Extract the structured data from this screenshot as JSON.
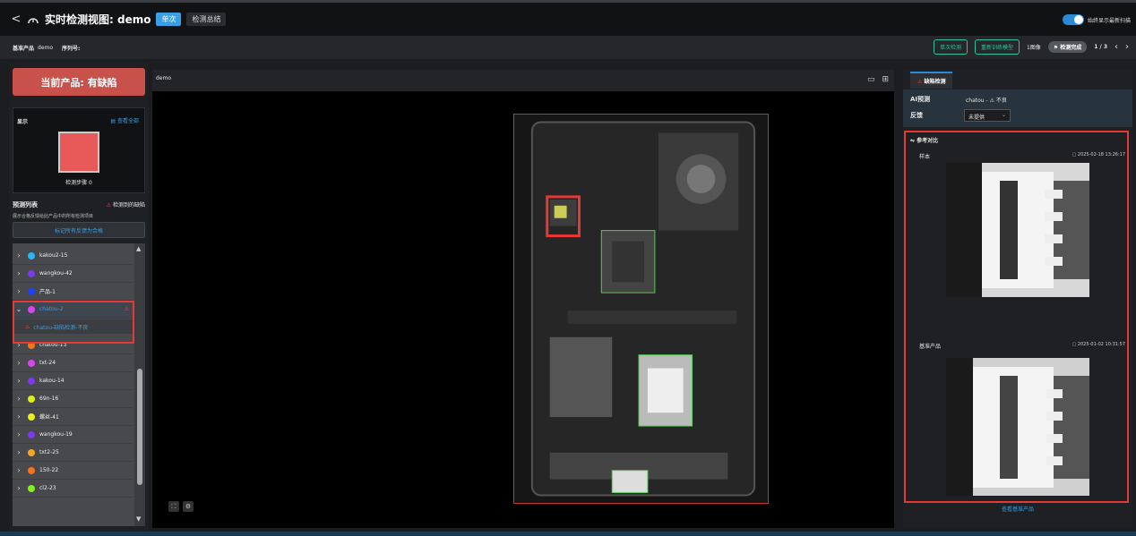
{
  "header": {
    "back": "<",
    "title": "实时检测视图: demo",
    "tab_single": "单次",
    "tab_summary": "检测总结",
    "toggle_label": "始终显示最新扫描"
  },
  "subbar": {
    "product_label": "基准产品",
    "product_value": "demo",
    "serial_label": "序列号:",
    "single_btn": "单次检测",
    "retrain_btn": "重新训练模型",
    "image_count": "1图像",
    "status_chip": "检测完成",
    "page": "1 / 3"
  },
  "left": {
    "banner": "当前产品: 有缺陷",
    "display_title": "显示",
    "view_all": "查看全部",
    "step_label": "检测步骤 0",
    "pred_title": "预测列表",
    "pred_warn": "检测到的缺陷",
    "pred_desc": "展示合格反馈给此产品中的所有检测项目",
    "mark_btn": "标记所有反馈为合格",
    "items": [
      {
        "name": "kakou2-15",
        "color": "#29b6f6"
      },
      {
        "name": "wangkou-42",
        "color": "#7c3aed"
      },
      {
        "name": "产品-1",
        "color": "#1e40ff"
      },
      {
        "name": "chatou-2",
        "color": "#d946ef"
      },
      {
        "name": "chatou-13",
        "color": "#f97316"
      },
      {
        "name": "txt-24",
        "color": "#d946ef"
      },
      {
        "name": "kakou-14",
        "color": "#7c3aed"
      },
      {
        "name": "69n-16",
        "color": "#d9f21a"
      },
      {
        "name": "螺丝-41",
        "color": "#e9f21a"
      },
      {
        "name": "wangkou-19",
        "color": "#7c3aed"
      },
      {
        "name": "txt2-25",
        "color": "#f5a623"
      },
      {
        "name": "150-22",
        "color": "#f97316"
      },
      {
        "name": "cl2-23",
        "color": "#84f21a"
      }
    ],
    "sub_item": "chatou-缺陷检测-不良"
  },
  "center": {
    "label": "demo"
  },
  "right": {
    "tab": "缺陷检测",
    "ai_label": "AI预测",
    "ai_value": "chatou - ⚠ 不良",
    "feedback_label": "反馈",
    "feedback_value": "未提供",
    "ref_title": "参考对比",
    "sample_label": "样本",
    "sample_date": "2025-02-18 13:26:17",
    "base_label": "基准产品",
    "base_date": "2025-01-02 10:31:57",
    "view_base": "查看基准产品"
  }
}
